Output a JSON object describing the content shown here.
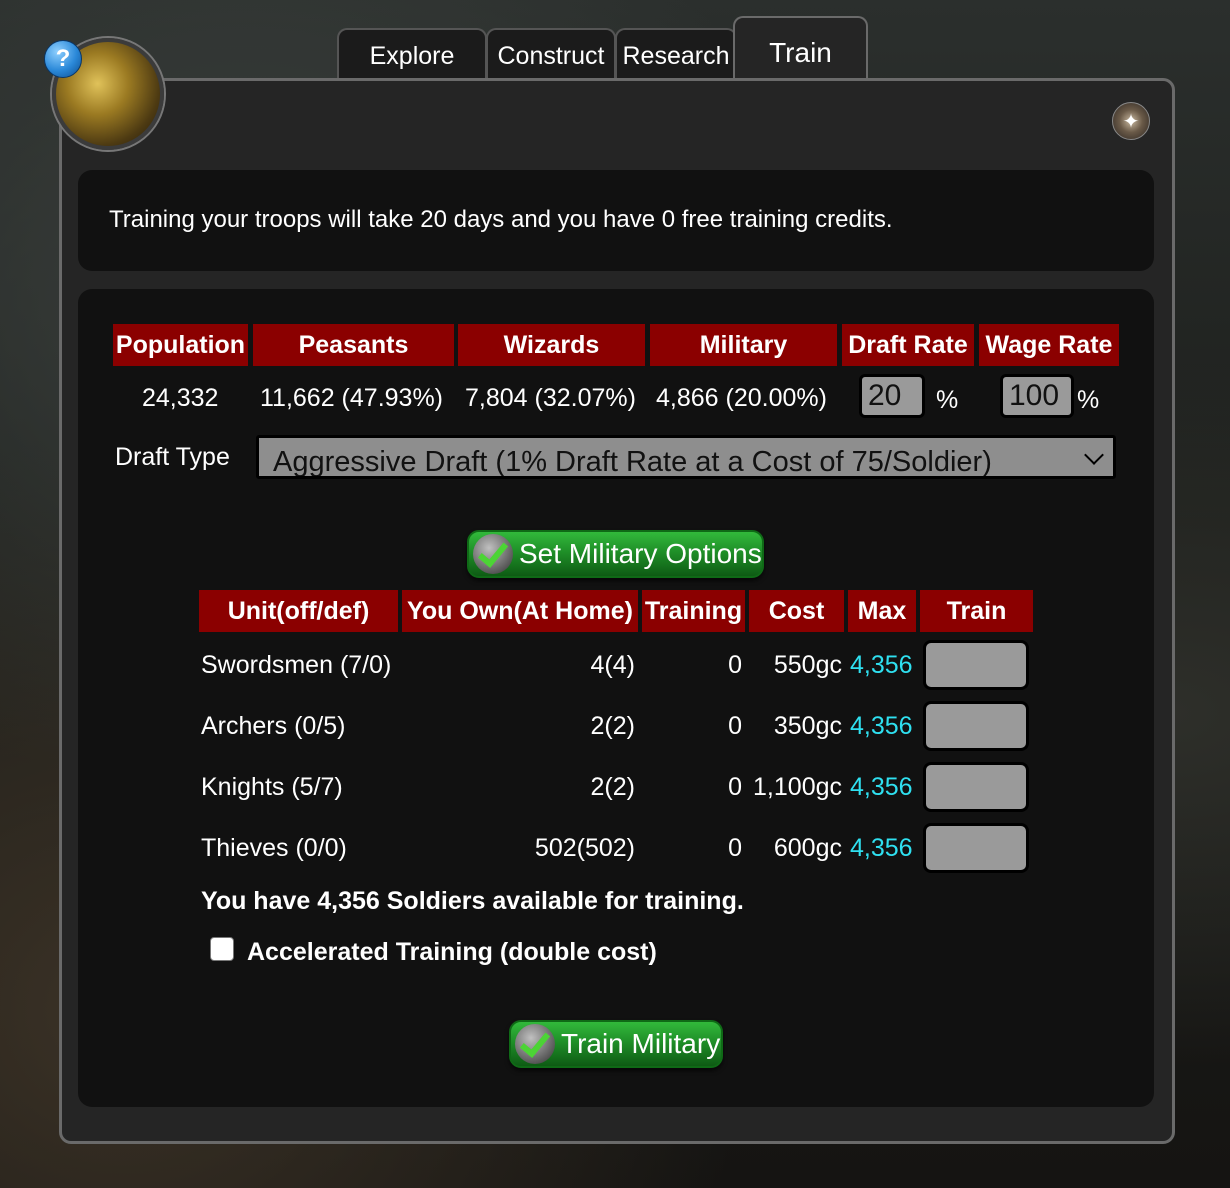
{
  "tabs": [
    {
      "label": "Explore"
    },
    {
      "label": "Construct"
    },
    {
      "label": "Research"
    },
    {
      "label": "Train"
    }
  ],
  "help_icon": "?",
  "info_text": "Training your troops will take 20 days and you have 0 free training credits.",
  "stats": {
    "headers": [
      "Population",
      "Peasants",
      "Wizards",
      "Military",
      "Draft Rate",
      "Wage Rate"
    ],
    "population": "24,332",
    "peasants": "11,662 (47.93%)",
    "wizards": "7,804 (32.07%)",
    "military": "4,866 (20.00%)",
    "draft_rate": "20",
    "wage_rate": "100",
    "percent_sign": "%"
  },
  "draft": {
    "label": "Draft Type",
    "selected": "Aggressive Draft (1% Draft Rate at a Cost of 75/Soldier)"
  },
  "buttons": {
    "set_military": "Set Military Options",
    "train_military": "Train Military"
  },
  "units": {
    "headers": [
      "Unit(off/def)",
      "You Own(At Home)",
      "Training",
      "Cost",
      "Max",
      "Train"
    ],
    "rows": [
      {
        "unit": "Swordsmen (7/0)",
        "own": "4(4)",
        "training": "0",
        "cost": "550gc",
        "max": "4,356"
      },
      {
        "unit": "Archers (0/5)",
        "own": "2(2)",
        "training": "0",
        "cost": "350gc",
        "max": "4,356"
      },
      {
        "unit": "Knights (5/7)",
        "own": "2(2)",
        "training": "0",
        "cost": "1,100gc",
        "max": "4,356"
      },
      {
        "unit": "Thieves (0/0)",
        "own": "502(502)",
        "training": "0",
        "cost": "600gc",
        "max": "4,356"
      }
    ]
  },
  "soldiers_text": "You have 4,356 Soldiers available for training.",
  "accelerated_label": "Accelerated Training (double cost)",
  "colors": {
    "header_red": "#8b0000",
    "max_cyan": "#2fe0f0",
    "button_green": "#1f8f28"
  },
  "icons": {
    "help": "question-mark-icon",
    "settings": "settings-icon",
    "check": "checkmark-icon"
  }
}
